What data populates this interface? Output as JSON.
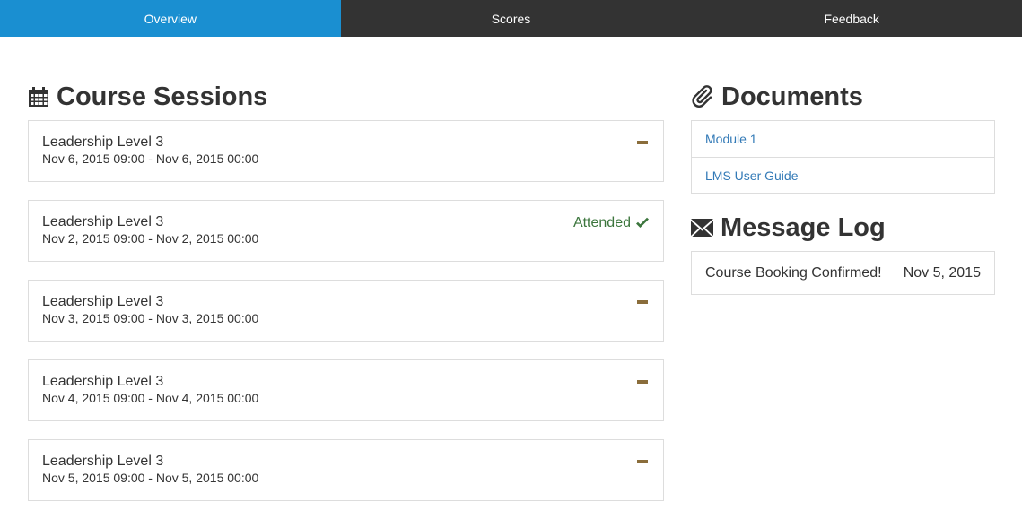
{
  "tabs": [
    {
      "label": "Overview",
      "active": true
    },
    {
      "label": "Scores",
      "active": false
    },
    {
      "label": "Feedback",
      "active": false
    }
  ],
  "sessions_section": {
    "title": "Course Sessions",
    "icon": "calendar-icon",
    "items": [
      {
        "name": "Leadership Level 3",
        "dates": "Nov 6, 2015 09:00 - Nov 6, 2015 00:00",
        "status": "",
        "status_icon": "minus-icon"
      },
      {
        "name": "Leadership Level 3",
        "dates": "Nov 2, 2015 09:00 - Nov 2, 2015 00:00",
        "status": "Attended",
        "status_icon": "check-icon"
      },
      {
        "name": "Leadership Level 3",
        "dates": "Nov 3, 2015 09:00 - Nov 3, 2015 00:00",
        "status": "",
        "status_icon": "minus-icon"
      },
      {
        "name": "Leadership Level 3",
        "dates": "Nov 4, 2015 09:00 - Nov 4, 2015 00:00",
        "status": "",
        "status_icon": "minus-icon"
      },
      {
        "name": "Leadership Level 3",
        "dates": "Nov 5, 2015 09:00 - Nov 5, 2015 00:00",
        "status": "",
        "status_icon": "minus-icon"
      }
    ]
  },
  "documents_section": {
    "title": "Documents",
    "icon": "paperclip-icon",
    "items": [
      "Module 1",
      "LMS User Guide"
    ]
  },
  "message_log_section": {
    "title": "Message Log",
    "icon": "envelope-icon",
    "items": [
      {
        "message": "Course Booking Confirmed!",
        "date": "Nov 5, 2015"
      }
    ]
  },
  "colors": {
    "active_tab": "#1a8fd1",
    "tab_bar": "#333333",
    "attended": "#3c763d",
    "pending_marker": "#8a6d3b",
    "link": "#337ab7"
  }
}
